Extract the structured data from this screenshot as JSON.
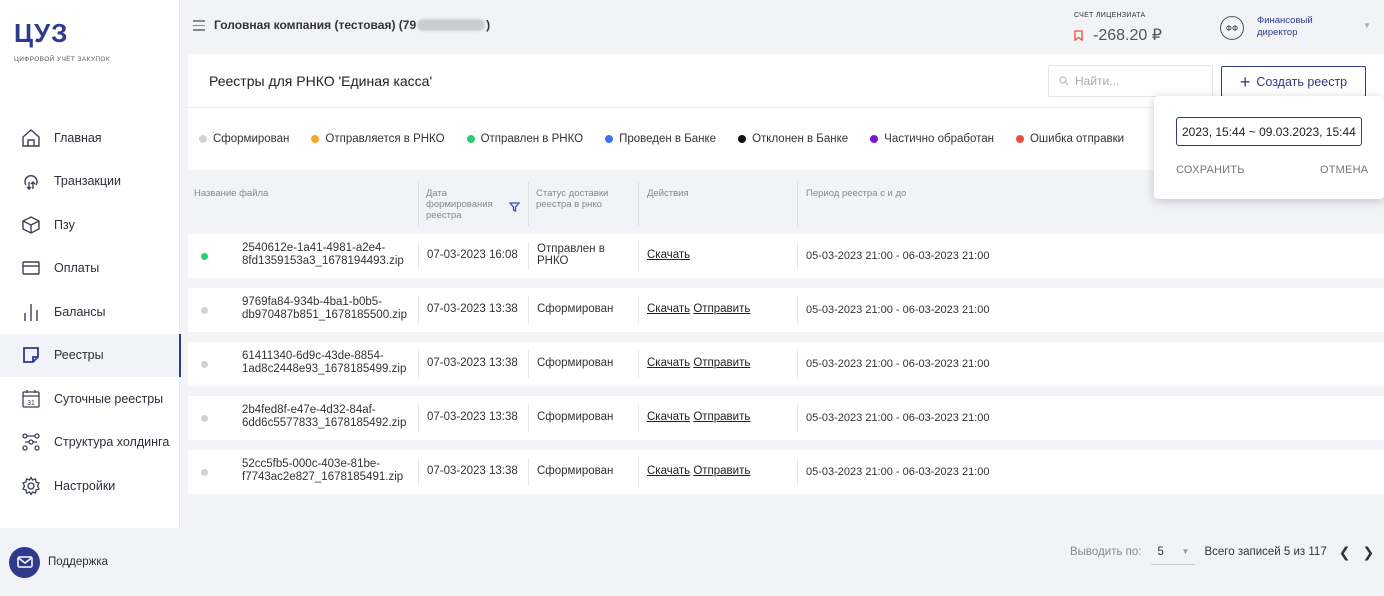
{
  "app": {
    "logo": "ЦУЗ",
    "logo_subtitle": "ЦИФРОВОЙ УЧЁТ ЗАКУПОК"
  },
  "sidebar": {
    "items": [
      {
        "label": "Главная",
        "icon": "home-icon"
      },
      {
        "label": "Транзакции",
        "icon": "transactions-icon"
      },
      {
        "label": "Пзу",
        "icon": "box-icon"
      },
      {
        "label": "Оплаты",
        "icon": "card-icon"
      },
      {
        "label": "Балансы",
        "icon": "bars-icon"
      },
      {
        "label": "Реестры",
        "icon": "note-icon",
        "active": true
      },
      {
        "label": "Суточные реестры",
        "icon": "calendar-icon"
      },
      {
        "label": "Структура холдинга",
        "icon": "hierarchy-icon"
      },
      {
        "label": "Настройки",
        "icon": "gear-icon"
      }
    ],
    "support_label": "Поддержка"
  },
  "header": {
    "company_prefix": "Головная компания (тестовая) (79",
    "company_suffix": ")",
    "license_label": "СЧЕТ ЛИЦЕНЗИАТА",
    "license_amount": "-268.20 ₽",
    "role_initials": "ФФ",
    "role_name": "Финансовый директор"
  },
  "page": {
    "title": "Реестры для РНКО 'Единая касса'",
    "search_placeholder": "Найти...",
    "create_label": "Создать реестр"
  },
  "legend": [
    {
      "label": "Сформирован",
      "color": "#cfd2d8"
    },
    {
      "label": "Отправляется в РНКО",
      "color": "#f5a623"
    },
    {
      "label": "Отправлен в РНКО",
      "color": "#2ecc71"
    },
    {
      "label": "Проведен в Банке",
      "color": "#3b6ff5"
    },
    {
      "label": "Отклонен в Банке",
      "color": "#111111"
    },
    {
      "label": "Частично обработан",
      "color": "#7b16d6"
    },
    {
      "label": "Ошибка отправки",
      "color": "#f04a3e"
    }
  ],
  "table": {
    "headers": {
      "file": "Название файла",
      "date": "Дата формирования реестра",
      "status": "Статус доставки реестра в рнко",
      "actions": "Действия",
      "period": "Период реестра с и до"
    },
    "rows": [
      {
        "dot_color": "#2ecc71",
        "file": "2540612e-1a41-4981-a2e4-8fd1359153a3_1678194493.zip",
        "date": "07-03-2023 16:08",
        "status": "Отправлен в РНКО",
        "download": "Скачать",
        "send": "",
        "period": "05-03-2023 21:00 - 06-03-2023 21:00"
      },
      {
        "dot_color": "#cfd2d8",
        "file": "9769fa84-934b-4ba1-b0b5-db970487b851_1678185500.zip",
        "date": "07-03-2023 13:38",
        "status": "Сформирован",
        "download": "Скачать",
        "send": "Отправить",
        "period": "05-03-2023 21:00 - 06-03-2023 21:00"
      },
      {
        "dot_color": "#cfd2d8",
        "file": "61411340-6d9c-43de-8854-1ad8c2448e93_1678185499.zip",
        "date": "07-03-2023 13:38",
        "status": "Сформирован",
        "download": "Скачать",
        "send": "Отправить",
        "period": "05-03-2023 21:00 - 06-03-2023 21:00"
      },
      {
        "dot_color": "#cfd2d8",
        "file": "2b4fed8f-e47e-4d32-84af-6dd6c5577833_1678185492.zip",
        "date": "07-03-2023 13:38",
        "status": "Сформирован",
        "download": "Скачать",
        "send": "Отправить",
        "period": "05-03-2023 21:00 - 06-03-2023 21:00"
      },
      {
        "dot_color": "#cfd2d8",
        "file": "52cc5fb5-000c-403e-81be-f7743ac2e827_1678185491.zip",
        "date": "07-03-2023 13:38",
        "status": "Сформирован",
        "download": "Скачать",
        "send": "Отправить",
        "period": "05-03-2023 21:00 - 06-03-2023 21:00"
      }
    ]
  },
  "pager": {
    "per_page_label": "Выводить по:",
    "per_page_value": "5",
    "total_label": "Всего записей 5 из 117"
  },
  "popup": {
    "range_value": "2023, 15:44 ~ 09.03.2023, 15:44",
    "save_label": "СОХРАНИТЬ",
    "cancel_label": "ОТМЕНА"
  }
}
